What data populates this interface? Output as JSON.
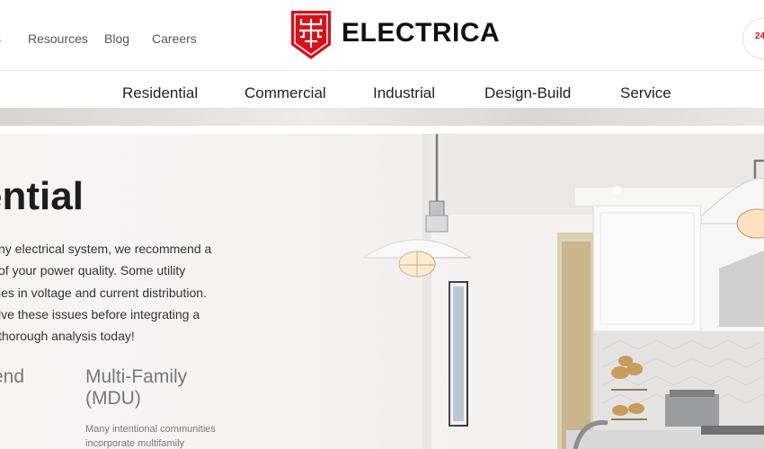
{
  "header": {
    "nav_links": [
      "s",
      "Resources",
      "Blog",
      "Careers"
    ],
    "brand_name": "ELECTRICA",
    "badge_text": "24",
    "accent_color": "#d8101a"
  },
  "main_nav": [
    "Residential",
    "Commercial",
    "Industrial",
    "Design-Build",
    "Service"
  ],
  "hero": {
    "title": "ential",
    "intro_lines": [
      "ny electrical system, we recommend a",
      "of your power quality. Some utility",
      "ies in voltage and current distribution.",
      "lve these issues before integrating a",
      "thorough analysis today!"
    ],
    "categories": [
      {
        "title": "end",
        "description": ""
      },
      {
        "title": "Multi-Family (MDU)",
        "description": "Many intentional communities incorporate multifamily"
      }
    ]
  }
}
